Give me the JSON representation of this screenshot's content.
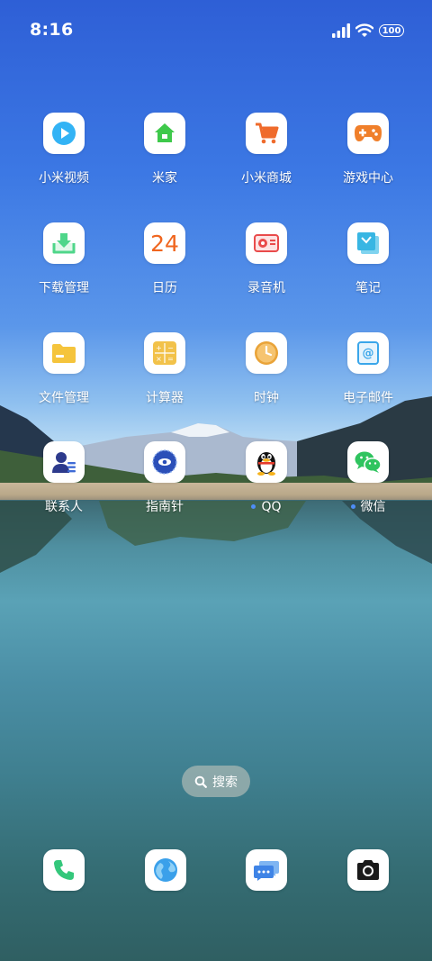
{
  "status_bar": {
    "time": "8:16",
    "battery": "100",
    "icons": [
      "signal-icon",
      "wifi-icon",
      "battery-icon"
    ]
  },
  "apps": [
    {
      "label": "小米视频",
      "icon": "play-icon"
    },
    {
      "label": "米家",
      "icon": "home-icon"
    },
    {
      "label": "小米商城",
      "icon": "cart-icon"
    },
    {
      "label": "游戏中心",
      "icon": "gamepad-icon"
    },
    {
      "label": "下载管理",
      "icon": "download-icon"
    },
    {
      "label": "日历",
      "icon": "calendar-icon",
      "text": "24"
    },
    {
      "label": "录音机",
      "icon": "recorder-icon"
    },
    {
      "label": "笔记",
      "icon": "notes-icon"
    },
    {
      "label": "文件管理",
      "icon": "folder-icon"
    },
    {
      "label": "计算器",
      "icon": "calculator-icon"
    },
    {
      "label": "时钟",
      "icon": "clock-icon"
    },
    {
      "label": "电子邮件",
      "icon": "email-icon",
      "text": "@"
    },
    {
      "label": "联系人",
      "icon": "contacts-icon"
    },
    {
      "label": "指南针",
      "icon": "compass-icon"
    },
    {
      "label": "QQ",
      "icon": "qq-penguin-icon",
      "badge_dot": true
    },
    {
      "label": "微信",
      "icon": "wechat-icon",
      "badge_dot": true
    }
  ],
  "search": {
    "label": "搜索"
  },
  "dock": [
    {
      "icon": "phone-icon"
    },
    {
      "icon": "browser-icon"
    },
    {
      "icon": "messages-icon"
    },
    {
      "icon": "camera-icon"
    }
  ],
  "colors": {
    "play": "#33b3f5",
    "home_green": "#3ec94b",
    "cart_orange": "#ef6b2c",
    "game_orange": "#f07f2a",
    "download_green": "#4fd68a",
    "calendar_orange": "#f0661f",
    "recorder_red": "#e94b4b",
    "notes_blue": "#38b6e3",
    "folder_yellow": "#f5c43c",
    "calculator_yellow": "#f2c24a",
    "clock_orange": "#e9a338",
    "email_blue": "#3aa6ea",
    "contacts_navy": "#2d3a8c",
    "compass_blue": "#2b4fb8",
    "wechat_green": "#2fc45f",
    "badge_blue": "#4e8df7"
  }
}
